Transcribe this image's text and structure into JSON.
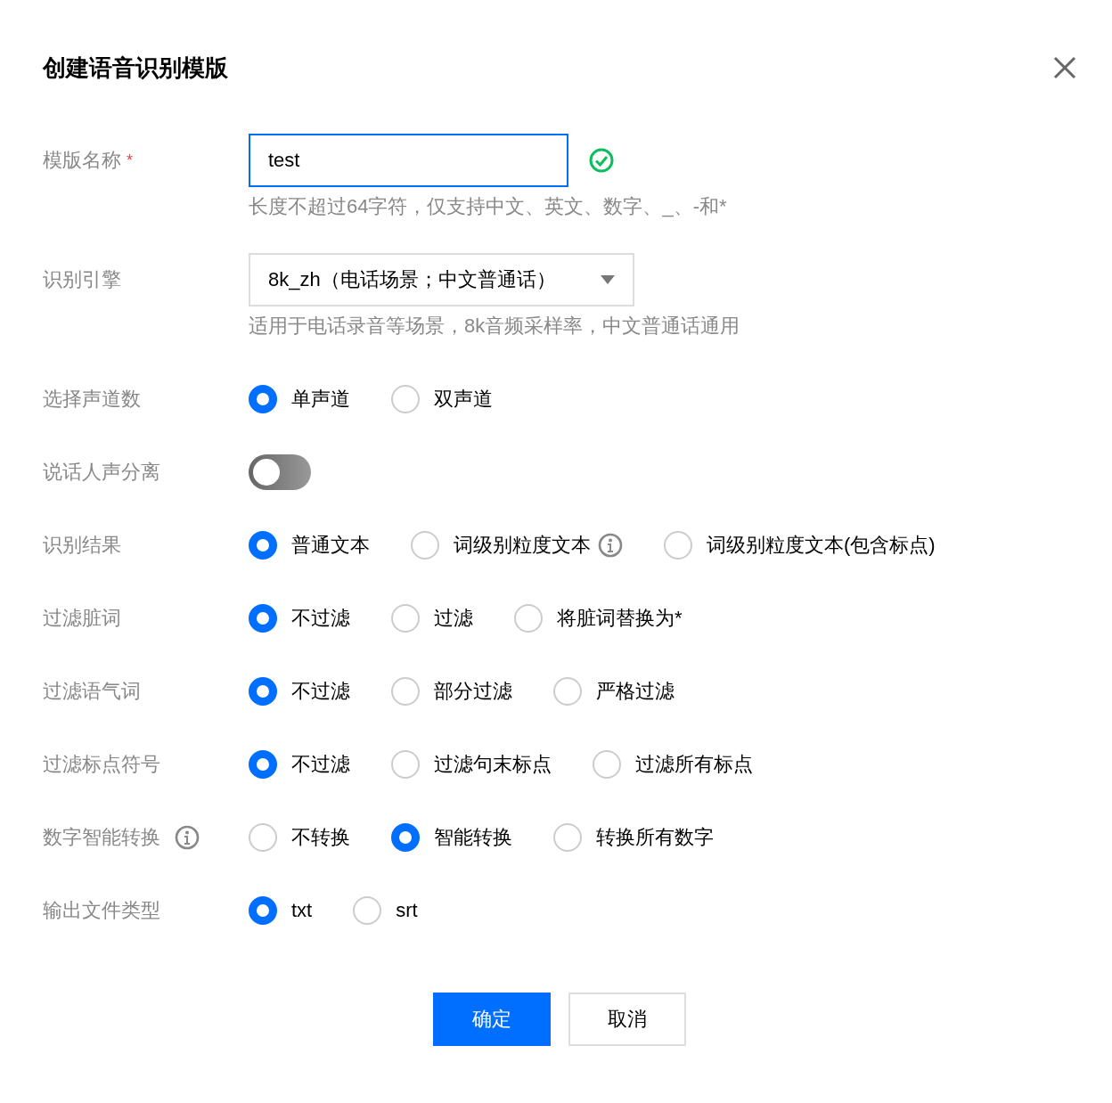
{
  "dialog": {
    "title": "创建语音识别模版"
  },
  "fields": [
    {
      "kind": "text",
      "label": "模版名称",
      "required_mark": "*",
      "info": false,
      "value": "test",
      "focused": true,
      "valid": true,
      "hint": "长度不超过64字符，仅支持中文、英文、数字、_、-和*"
    },
    {
      "kind": "select",
      "label": "识别引擎",
      "info": false,
      "value": "8k_zh（电话场景；中文普通话）",
      "hint": "适用于电话录音等场景，8k音频采样率，中文普通话通用"
    },
    {
      "kind": "radio",
      "label": "选择声道数",
      "info": false,
      "options": [
        {
          "label": "单声道",
          "selected": true,
          "info": false
        },
        {
          "label": "双声道",
          "selected": false,
          "info": false
        }
      ]
    },
    {
      "kind": "switch",
      "label": "说话人声分离",
      "info": false,
      "on": false
    },
    {
      "kind": "radio",
      "label": "识别结果",
      "info": false,
      "options": [
        {
          "label": "普通文本",
          "selected": true,
          "info": false
        },
        {
          "label": "词级别粒度文本",
          "selected": false,
          "info": true
        },
        {
          "label": "词级别粒度文本(包含标点)",
          "selected": false,
          "info": false
        }
      ]
    },
    {
      "kind": "radio",
      "label": "过滤脏词",
      "info": false,
      "options": [
        {
          "label": "不过滤",
          "selected": true,
          "info": false
        },
        {
          "label": "过滤",
          "selected": false,
          "info": false
        },
        {
          "label": "将脏词替换为*",
          "selected": false,
          "info": false
        }
      ]
    },
    {
      "kind": "radio",
      "label": "过滤语气词",
      "info": false,
      "options": [
        {
          "label": "不过滤",
          "selected": true,
          "info": false
        },
        {
          "label": "部分过滤",
          "selected": false,
          "info": false
        },
        {
          "label": "严格过滤",
          "selected": false,
          "info": false
        }
      ]
    },
    {
      "kind": "radio",
      "label": "过滤标点符号",
      "info": false,
      "options": [
        {
          "label": "不过滤",
          "selected": true,
          "info": false
        },
        {
          "label": "过滤句末标点",
          "selected": false,
          "info": false
        },
        {
          "label": "过滤所有标点",
          "selected": false,
          "info": false
        }
      ]
    },
    {
      "kind": "radio",
      "label": "数字智能转换",
      "info": true,
      "options": [
        {
          "label": "不转换",
          "selected": false,
          "info": false
        },
        {
          "label": "智能转换",
          "selected": true,
          "info": false
        },
        {
          "label": "转换所有数字",
          "selected": false,
          "info": false
        }
      ]
    },
    {
      "kind": "radio",
      "label": "输出文件类型",
      "info": false,
      "options": [
        {
          "label": "txt",
          "selected": true,
          "info": false
        },
        {
          "label": "srt",
          "selected": false,
          "info": false
        }
      ]
    }
  ],
  "buttons": [
    {
      "label": "确定",
      "kind": "primary"
    },
    {
      "label": "取消",
      "kind": "default"
    }
  ]
}
